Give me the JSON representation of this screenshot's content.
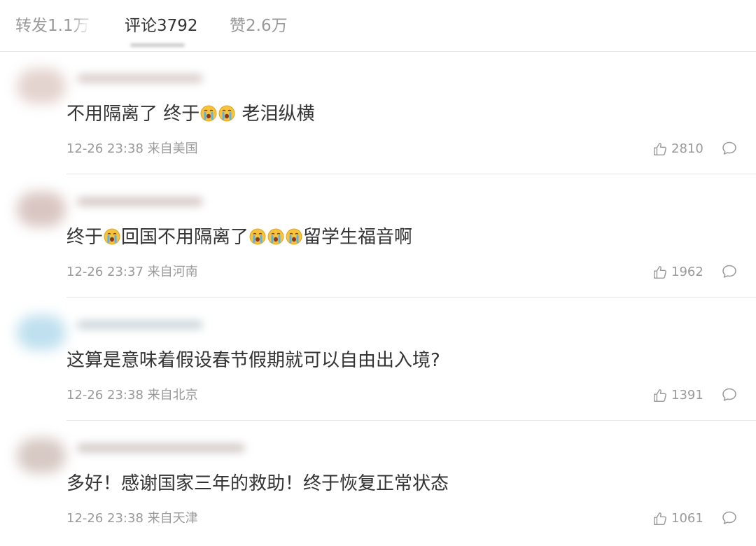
{
  "tabs": [
    {
      "label": "转发1.1万",
      "active": false
    },
    {
      "label": "评论3792",
      "active": true
    },
    {
      "label": "赞2.6万",
      "active": false
    }
  ],
  "comments": [
    {
      "text_parts": [
        "不用隔离了 终于",
        "",
        " 老泪纵横"
      ],
      "emojis": [
        "crying-face",
        "crying-face"
      ],
      "meta": "12-26 23:38 来自美国",
      "likes": "2810"
    },
    {
      "text_parts": [
        "终于",
        "回国不用隔离了",
        "留学生福音啊"
      ],
      "emojis": [
        "crying-face",
        "crying-face",
        "crying-face",
        "crying-face"
      ],
      "meta": "12-26 23:37 来自河南",
      "likes": "1962"
    },
    {
      "text": "这算是意味着假设春节假期就可以自由出入境?",
      "meta": "12-26 23:38 来自北京",
      "likes": "1391"
    },
    {
      "text": "多好！感谢国家三年的救助！终于恢复正常状态",
      "meta": "12-26 23:38 来自天津",
      "likes": "1061"
    }
  ],
  "colors": {
    "text": "#333333",
    "muted": "#999999",
    "divider": "#e6e6e6",
    "emoji_face": "#f7c23c"
  }
}
